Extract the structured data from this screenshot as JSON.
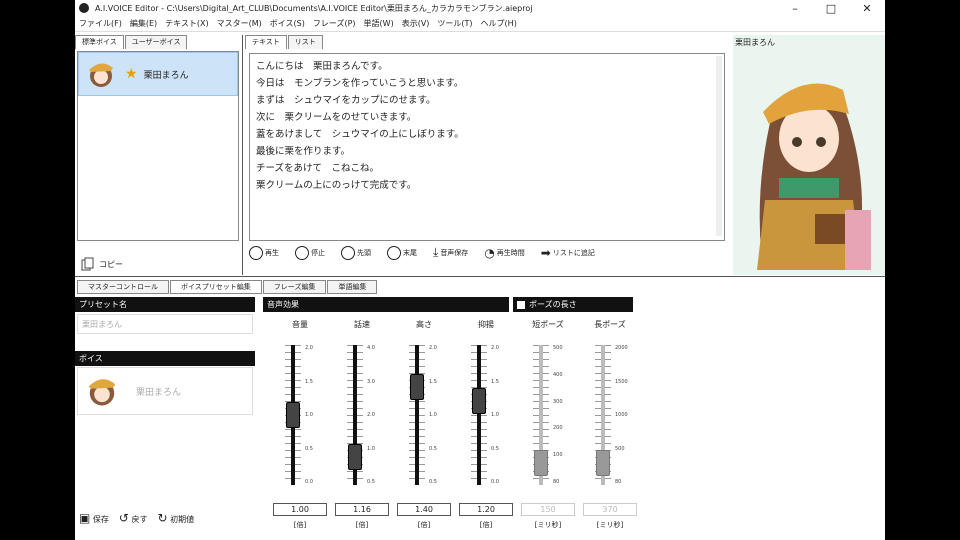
{
  "window": {
    "title": "A.I.VOICE Editor - C:\\Users\\Digital_Art_CLUB\\Documents\\A.I.VOICE Editor\\栗田まろん_カラカラモンブラン.aieproj",
    "controls": [
      "–",
      "□",
      "✕"
    ]
  },
  "menu": [
    "ファイル(F)",
    "編集(E)",
    "テキスト(X)",
    "マスター(M)",
    "ボイス(S)",
    "フレーズ(P)",
    "単語(W)",
    "表示(V)",
    "ツール(T)",
    "ヘルプ(H)"
  ],
  "left": {
    "tabs": [
      "標準ボイス",
      "ユーザーボイス"
    ],
    "voice_name": "栗田まろん",
    "copy_label": "コピー"
  },
  "center": {
    "tabs": [
      "テキスト",
      "リスト"
    ],
    "lines": [
      "こんにちは　栗田まろんです。",
      "今日は　モンブランを作っていこうと思います。",
      "まずは　シュウマイをカップにのせます。",
      "次に　栗クリームをのせていきます。",
      "蓋をあけまして　シュウマイの上にしぼります。",
      "最後に栗を作ります。",
      "チーズをあけて　こねこね。",
      "栗クリームの上にのっけて完成です。"
    ],
    "toolbar": [
      "再生",
      "停止",
      "先頭",
      "末尾",
      "音声保存",
      "再生時間",
      "リストに追記"
    ]
  },
  "right": {
    "name": "栗田まろん"
  },
  "bottom": {
    "tabs": [
      "マスターコントロール",
      "ボイスプリセット編集",
      "フレーズ編集",
      "単語編集"
    ],
    "preset_header": "プリセット名",
    "preset_value": "栗田まろん",
    "voice_header": "ボイス",
    "voice_value": "栗田まろん",
    "buttons": [
      "保存",
      "戻す",
      "初期値"
    ]
  },
  "effects": {
    "header": "音声効果",
    "pause_header": "ポーズの長さ",
    "sliders": [
      {
        "label": "音量",
        "value": "1.00",
        "unit": "[倍]",
        "level": 0.5,
        "scale": [
          "2.0",
          "1.5",
          "1.0",
          "0.5",
          "0.0"
        ]
      },
      {
        "label": "話速",
        "value": "1.16",
        "unit": "[倍]",
        "level": 0.2,
        "scale": [
          "4.0",
          "3.0",
          "2.0",
          "1.0",
          "0.5"
        ]
      },
      {
        "label": "高さ",
        "value": "1.40",
        "unit": "[倍]",
        "level": 0.7,
        "scale": [
          "2.0",
          "1.5",
          "1.0",
          "0.5",
          "0.5"
        ]
      },
      {
        "label": "抑揚",
        "value": "1.20",
        "unit": "[倍]",
        "level": 0.6,
        "scale": [
          "2.0",
          "1.5",
          "1.0",
          "0.5",
          "0.0"
        ]
      },
      {
        "label": "短ポーズ",
        "value": "150",
        "unit": "[ミリ秒]",
        "level": 0.16,
        "scale": [
          "500",
          "400",
          "300",
          "200",
          "100",
          "80"
        ],
        "disabled": true
      },
      {
        "label": "長ポーズ",
        "value": "370",
        "unit": "[ミリ秒]",
        "level": 0.16,
        "scale": [
          "2000",
          "1500",
          "1000",
          "500",
          "80"
        ],
        "disabled": true
      }
    ]
  }
}
